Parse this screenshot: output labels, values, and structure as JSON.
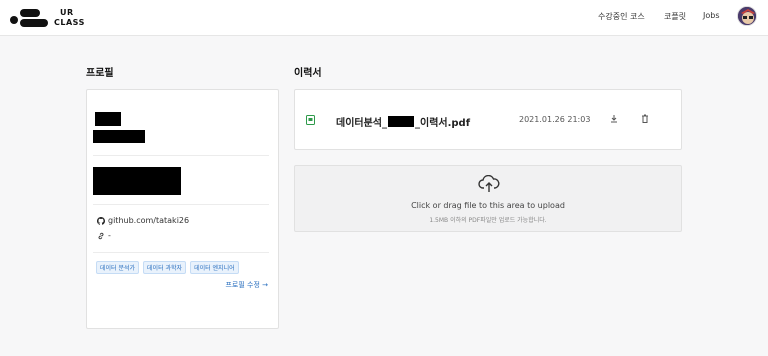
{
  "header": {
    "logo_text_top": "UR",
    "logo_text_bottom": "CLASS",
    "nav": [
      "수강중인 코스",
      "코플릿",
      "Jobs"
    ]
  },
  "profile": {
    "section_title": "프로필",
    "github": "github.com/tataki26",
    "website": "-",
    "tags": [
      "데이터 분석가",
      "데이터 과학자",
      "데이터 엔지니어"
    ],
    "edit_label": "프로필 수정 →"
  },
  "resume": {
    "section_title": "이력서",
    "file_name_prefix": "데이터분석_",
    "file_name_suffix": "_이력서.pdf",
    "file_date": "2021.01.26 21:03",
    "upload_text": "Click or drag file to this area to upload",
    "upload_sub": "1.5MB 이하의 PDF파일만 업로드 가능합니다."
  },
  "icons": {
    "logo": "urclass-logo",
    "avatar": "user-avatar",
    "github": "github-icon",
    "link": "link-icon",
    "file": "pdf-file-icon",
    "download": "download-icon",
    "delete": "trash-icon",
    "upload": "cloud-upload-icon"
  },
  "colors": {
    "accent": "#2a6fbf",
    "file_icon": "#2e9a4a",
    "background": "#f7f7f8"
  }
}
